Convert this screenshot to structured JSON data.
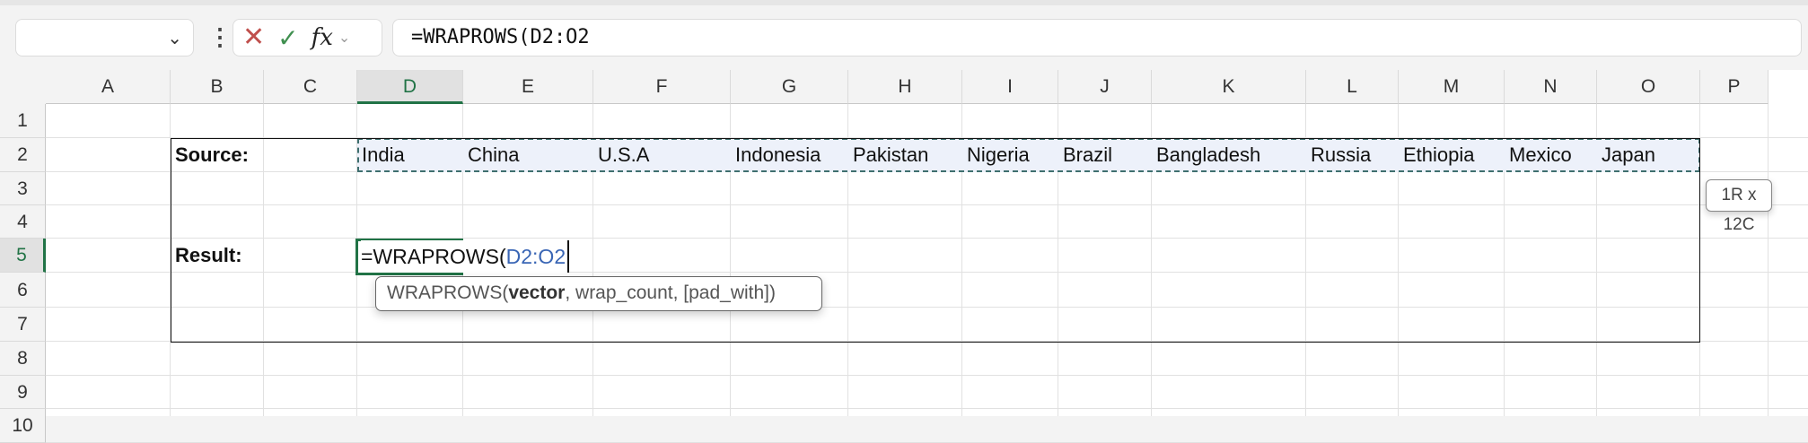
{
  "formula_bar": {
    "name_box": "",
    "formula": "=WRAPROWS(D2:O2",
    "cancel_icon": "x-icon",
    "enter_icon": "check-icon",
    "fx_label": "fx"
  },
  "columns": [
    "A",
    "B",
    "C",
    "D",
    "E",
    "F",
    "G",
    "H",
    "I",
    "J",
    "K",
    "L",
    "M",
    "N",
    "O",
    "P"
  ],
  "rows": [
    "1",
    "2",
    "3",
    "4",
    "5",
    "6",
    "7",
    "8",
    "9",
    "10"
  ],
  "selected_column": "D",
  "selected_row": "5",
  "cells": {
    "B2": "Source:",
    "B5": "Result:",
    "source": [
      "India",
      "China",
      "U.S.A",
      "Indonesia",
      "Pakistan",
      "Nigeria",
      "Brazil",
      "Bangladesh",
      "Russia",
      "Ethiopia",
      "Mexico",
      "Japan"
    ]
  },
  "edit": {
    "prefix": "=WRAPROWS(",
    "ref": "D2:O2"
  },
  "tooltip": {
    "fn": "WRAPROWS(",
    "arg1": "vector",
    "rest": ", wrap_count, [pad_with])"
  },
  "size_tip": "1R x 12C",
  "colors": {
    "accent": "#217346",
    "ref": "#3a66b5",
    "selection_fill": "#edf1fa"
  }
}
